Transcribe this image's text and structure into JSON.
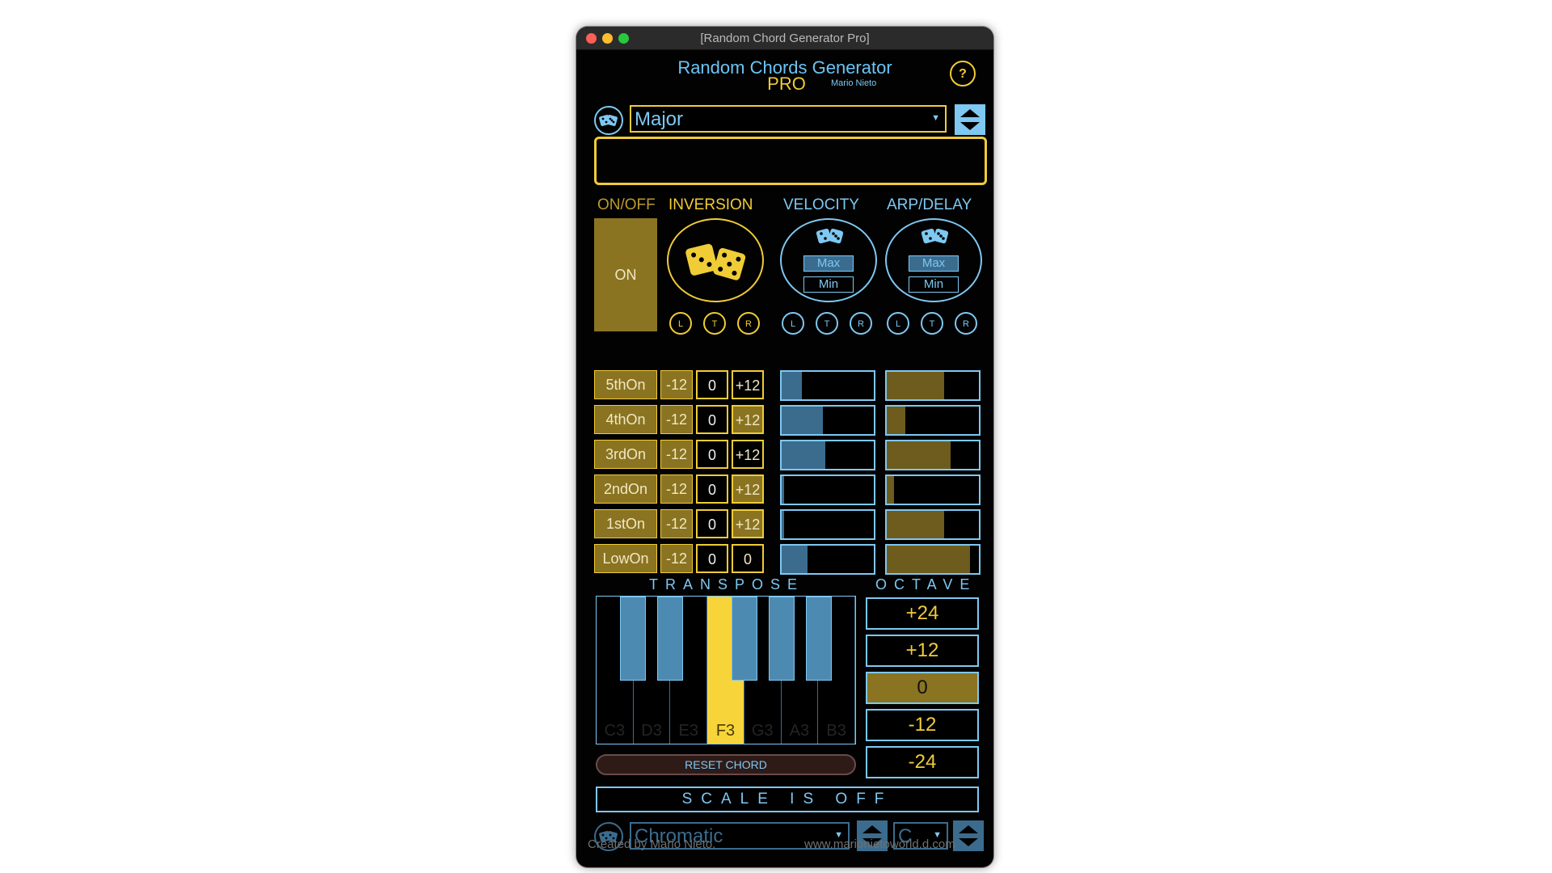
{
  "window": {
    "title": "[Random Chord Generator Pro]"
  },
  "header": {
    "title": "Random Chords Generator",
    "subtitle": "PRO",
    "author": "Mario Nieto",
    "help_label": "?"
  },
  "chord_type": {
    "value": "Major"
  },
  "chord_display": {
    "text": ""
  },
  "columns": {
    "onoff": "ON/OFF",
    "inversion": "INVERSION",
    "velocity": "VELOCITY",
    "arp_delay": "ARP/DELAY"
  },
  "onoff_button": {
    "label": "ON"
  },
  "velocity": {
    "max_label": "Max",
    "min_label": "Min"
  },
  "arp": {
    "max_label": "Max",
    "min_label": "Min"
  },
  "ltr": {
    "l": "L",
    "t": "T",
    "r": "R"
  },
  "voices": [
    {
      "name": "5thOn",
      "minus": "-12",
      "zero": "0",
      "plus": "+12",
      "velocity": 0.22,
      "arp": 0.62
    },
    {
      "name": "4thOn",
      "minus": "-12",
      "zero": "0",
      "plus": "+12",
      "velocity": 0.45,
      "arp": 0.2
    },
    {
      "name": "3rdOn",
      "minus": "-12",
      "zero": "0",
      "plus": "+12",
      "velocity": 0.47,
      "arp": 0.69
    },
    {
      "name": "2ndOn",
      "minus": "-12",
      "zero": "0",
      "plus": "+12",
      "velocity": 0.03,
      "arp": 0.08
    },
    {
      "name": "1stOn",
      "minus": "-12",
      "zero": "0",
      "plus": "+12",
      "velocity": 0.03,
      "arp": 0.62
    },
    {
      "name": "LowOn",
      "minus": "-12",
      "zero": "0",
      "plus": "0",
      "velocity": 0.28,
      "arp": 0.9
    }
  ],
  "transpose": {
    "label": "TRANSPOSE",
    "white_keys": [
      "C3",
      "D3",
      "E3",
      "F3",
      "G3",
      "A3",
      "B3"
    ],
    "selected": "F3"
  },
  "octave": {
    "label": "OCTAVE",
    "options": [
      "+24",
      "+12",
      "0",
      "-12",
      "-24"
    ],
    "selected": "0"
  },
  "reset_label": "RESET CHORD",
  "scale": {
    "status": "SCALE IS OFF",
    "value": "Chromatic",
    "root": "C"
  },
  "footer": {
    "credit": "Created by Mario Nieto.",
    "url": "www.marionietoworld.d.com"
  },
  "colors": {
    "accent_gold": "#f0cc36",
    "accent_blue": "#7ec8f2",
    "background": "#020202"
  }
}
